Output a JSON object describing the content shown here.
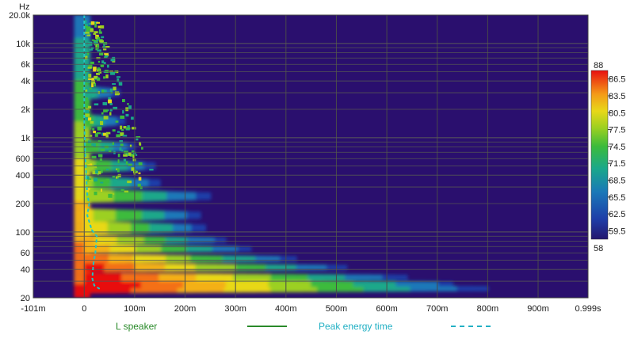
{
  "chart_data": {
    "type": "heatmap",
    "title": "",
    "ylabel": "Hz",
    "xlabel": "",
    "x_ticks": [
      "-101m",
      "0",
      "100m",
      "200m",
      "300m",
      "400m",
      "500m",
      "600m",
      "700m",
      "800m",
      "900m",
      "0.999s"
    ],
    "x_tick_values": [
      -0.101,
      0,
      0.1,
      0.2,
      0.3,
      0.4,
      0.5,
      0.6,
      0.7,
      0.8,
      0.9,
      0.999
    ],
    "y_ticks": [
      "20.0k",
      "10k",
      "6k",
      "4k",
      "2k",
      "1k",
      "600",
      "400",
      "200",
      "100",
      "60",
      "40",
      "20"
    ],
    "y_tick_values": [
      20000,
      10000,
      6000,
      4000,
      2000,
      1000,
      600,
      400,
      200,
      100,
      60,
      40,
      20
    ],
    "y_scale": "log",
    "xlim": [
      -0.101,
      0.999
    ],
    "ylim": [
      20,
      20000
    ],
    "colorbar": {
      "max_label": "88",
      "min_label": "58",
      "ticks": [
        "86.5",
        "83.5",
        "80.5",
        "77.5",
        "74.5",
        "71.5",
        "68.5",
        "65.5",
        "62.5",
        "59.5"
      ],
      "tick_values": [
        86.5,
        83.5,
        80.5,
        77.5,
        74.5,
        71.5,
        68.5,
        65.5,
        62.5,
        59.5
      ],
      "range": [
        58,
        88
      ]
    },
    "ridges": [
      {
        "freq": 25,
        "level": 86,
        "decay_end": 0.8
      },
      {
        "freq": 28,
        "level": 87,
        "decay_end": 0.73
      },
      {
        "freq": 33,
        "level": 85,
        "decay_end": 0.64
      },
      {
        "freq": 42,
        "level": 84,
        "decay_end": 0.52
      },
      {
        "freq": 52,
        "level": 82,
        "decay_end": 0.42
      },
      {
        "freq": 66,
        "level": 80,
        "decay_end": 0.33
      },
      {
        "freq": 82,
        "level": 78,
        "decay_end": 0.28
      },
      {
        "freq": 110,
        "level": 77,
        "decay_end": 0.24
      },
      {
        "freq": 150,
        "level": 75,
        "decay_end": 0.23
      },
      {
        "freq": 240,
        "level": 74,
        "decay_end": 0.25
      },
      {
        "freq": 330,
        "level": 72,
        "decay_end": 0.15
      },
      {
        "freq": 500,
        "level": 73,
        "decay_end": 0.14
      },
      {
        "freq": 800,
        "level": 71,
        "decay_end": 0.1
      },
      {
        "freq": 1500,
        "level": 70,
        "decay_end": 0.08
      },
      {
        "freq": 3000,
        "level": 68,
        "decay_end": 0.07
      }
    ],
    "series": [
      {
        "name": "Peak energy time",
        "color": "#22c4c4",
        "style": "dashed",
        "points": [
          {
            "x": 0.0,
            "y": 20000
          },
          {
            "x": 0.0,
            "y": 5000
          },
          {
            "x": 0.0,
            "y": 1500
          },
          {
            "x": 0.002,
            "y": 700
          },
          {
            "x": 0.004,
            "y": 400
          },
          {
            "x": 0.006,
            "y": 250
          },
          {
            "x": 0.01,
            "y": 200
          },
          {
            "x": 0.006,
            "y": 150
          },
          {
            "x": 0.015,
            "y": 105
          },
          {
            "x": 0.025,
            "y": 90
          },
          {
            "x": 0.022,
            "y": 60
          },
          {
            "x": 0.018,
            "y": 45
          },
          {
            "x": 0.016,
            "y": 32
          },
          {
            "x": 0.02,
            "y": 27
          },
          {
            "x": 0.03,
            "y": 25
          }
        ]
      }
    ],
    "legend": [
      {
        "label": "L speaker",
        "color": "#2a8a2a",
        "style": "solid"
      },
      {
        "label": "Peak energy time",
        "color": "#22b0c4",
        "style": "dashed"
      }
    ]
  }
}
